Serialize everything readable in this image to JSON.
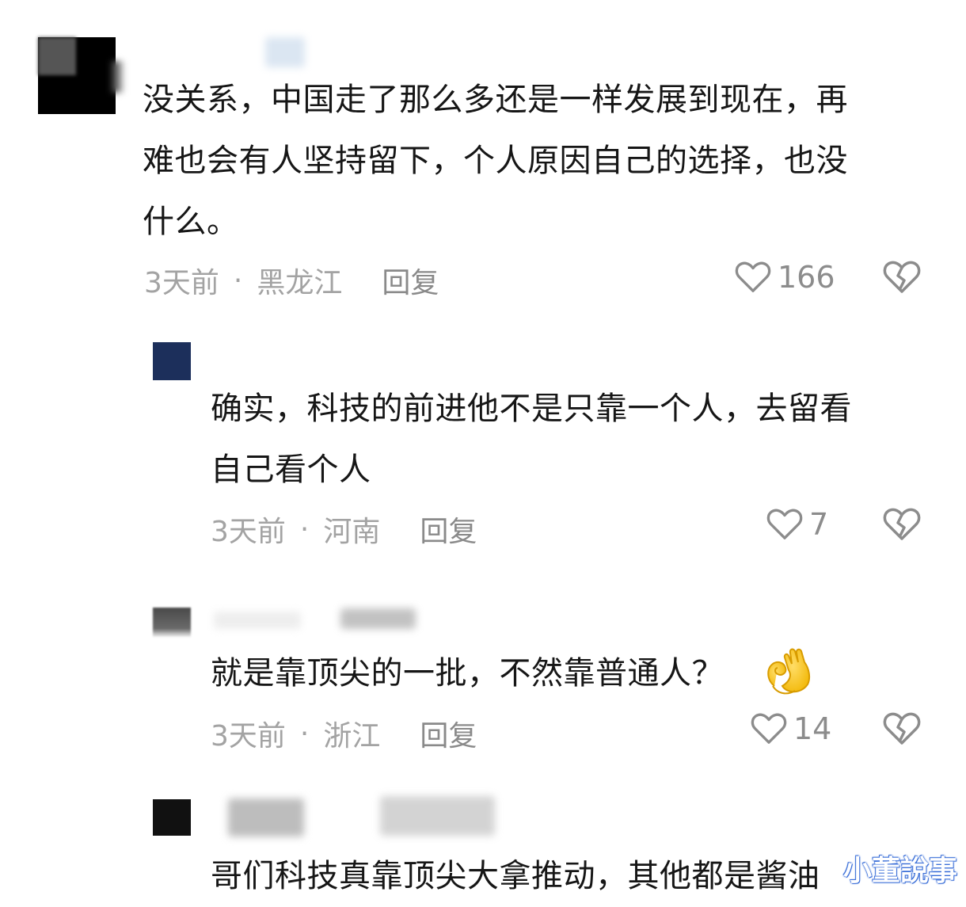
{
  "comments": [
    {
      "text": "没关系，中国走了那么多还是一样发展到现在，再\n难也会有人坚持留下，个人原因自己的选择，也没\n什么。",
      "time": "3天前",
      "separator": "·",
      "location": "黑龙江",
      "reply": "回复",
      "likes": "166"
    },
    {
      "text": "确实，科技的前进他不是只靠一个人，去留看\n自己看个人",
      "time": "3天前",
      "separator": "·",
      "location": "河南",
      "reply": "回复",
      "likes": "7"
    },
    {
      "text": "就是靠顶尖的一批，不然靠普通人？",
      "time": "3天前",
      "separator": "·",
      "location": "浙江",
      "reply": "回复",
      "likes": "14",
      "emoji": "ok-hand-emoji"
    },
    {
      "text": "哥们科技真靠顶尖大拿推动，其他都是酱油"
    }
  ],
  "watermark": "小董說事",
  "icons": {
    "like": "heart-outline-icon",
    "dislike": "broken-heart-icon"
  },
  "colors": {
    "meta_text": "#a3a3a3",
    "icon_stroke": "#8c8c8c",
    "avatar_2": "#1c2f5b",
    "watermark_outline": "#3b6fd8"
  }
}
